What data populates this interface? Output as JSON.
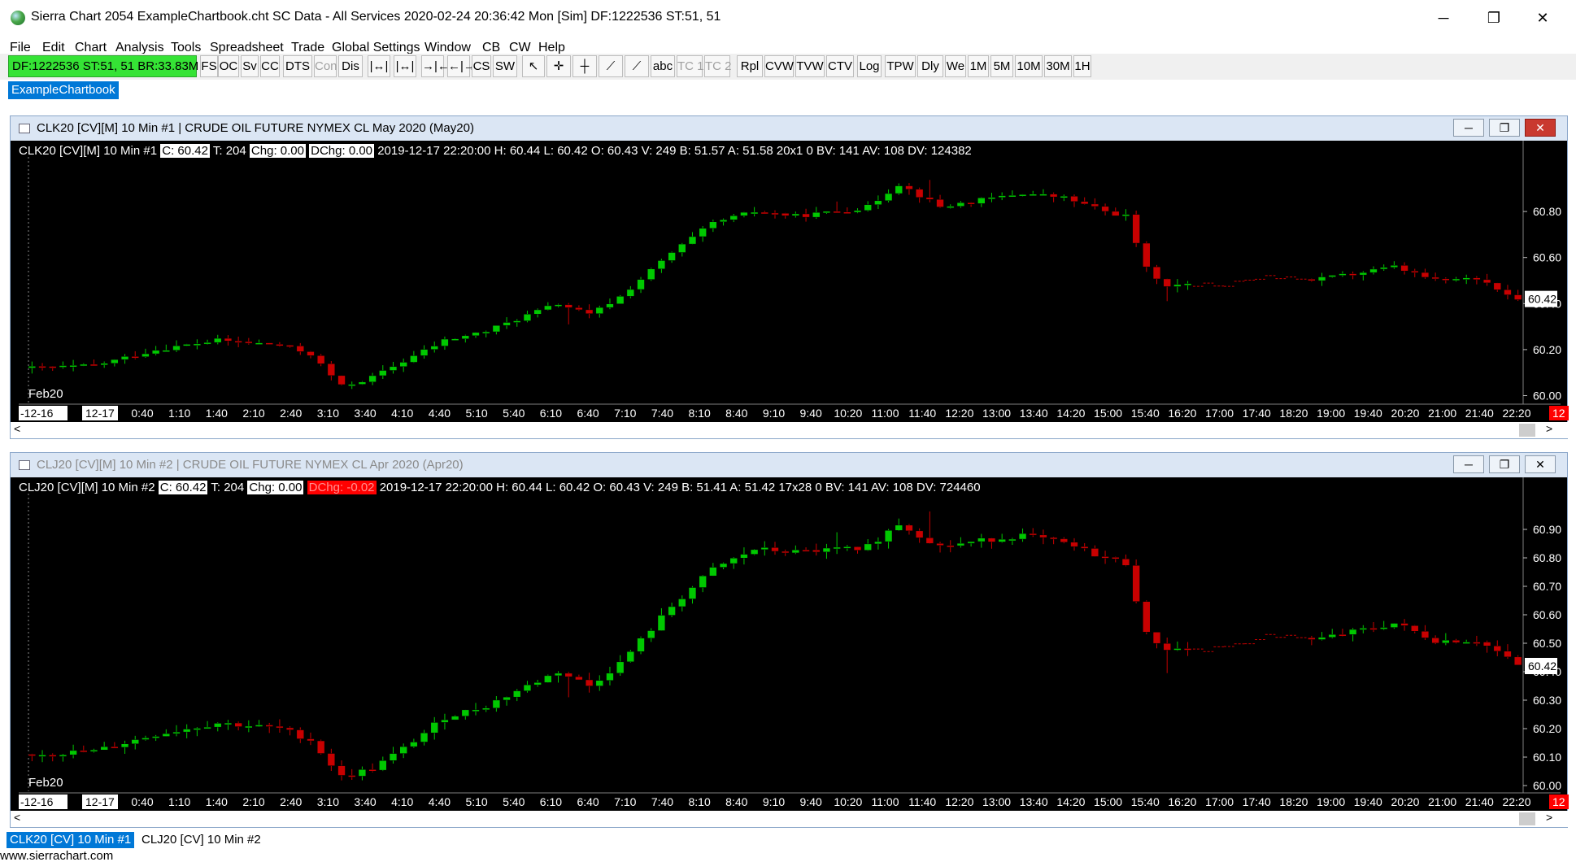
{
  "window": {
    "title": "Sierra Chart 2054 ExampleChartbook.cht  SC Data - All Services 2020-02-24  20:36:42 Mon [Sim]  DF:1222536  ST:51, 51",
    "minimize_glyph": "─",
    "maximize_glyph": "❐",
    "close_glyph": "✕"
  },
  "menu": [
    "File",
    "Edit",
    "Chart",
    "Analysis",
    "Tools",
    "Spreadsheet",
    "Trade",
    "Global Settings",
    "Window",
    "CB",
    "CW",
    "Help"
  ],
  "toolbar": {
    "status": "DF:1222536  ST:51, 51  BR:33.83M",
    "buttons": [
      {
        "label": "FS",
        "disabled": false
      },
      {
        "label": "OC",
        "disabled": false
      },
      {
        "label": "Sv",
        "disabled": false
      },
      {
        "label": "CC",
        "disabled": false
      },
      {
        "label": "DTS",
        "disabled": false
      },
      {
        "label": "Con",
        "disabled": true
      },
      {
        "label": "Dis",
        "disabled": false
      },
      {
        "label": "|↔|",
        "disabled": false
      },
      {
        "label": "|↔|",
        "disabled": false
      },
      {
        "label": "→|←",
        "disabled": false
      },
      {
        "label": "←|→",
        "disabled": false
      },
      {
        "label": "CS",
        "disabled": false
      },
      {
        "label": "SW",
        "disabled": false
      },
      {
        "label": "↖",
        "disabled": false
      },
      {
        "label": "✛",
        "disabled": false
      },
      {
        "label": "┼",
        "disabled": false
      },
      {
        "label": "⟋",
        "disabled": false
      },
      {
        "label": "⟋",
        "disabled": false
      },
      {
        "label": "abc",
        "disabled": false
      },
      {
        "label": "TC 1",
        "disabled": true
      },
      {
        "label": "TC 2",
        "disabled": true
      },
      {
        "label": "Rpl",
        "disabled": false
      },
      {
        "label": "CVW",
        "disabled": false
      },
      {
        "label": "TVW",
        "disabled": false
      },
      {
        "label": "CTV",
        "disabled": false
      },
      {
        "label": "Log",
        "disabled": false
      },
      {
        "label": "TPW",
        "disabled": false
      },
      {
        "label": "Dly",
        "disabled": false
      },
      {
        "label": "We",
        "disabled": false
      },
      {
        "label": "1M",
        "disabled": false
      },
      {
        "label": "5M",
        "disabled": false
      },
      {
        "label": "10M",
        "disabled": false
      },
      {
        "label": "30M",
        "disabled": false
      },
      {
        "label": "1H",
        "disabled": false
      }
    ]
  },
  "chartbook_tab": "ExampleChartbook",
  "time_labels": [
    "0:40",
    "1:10",
    "1:40",
    "2:10",
    "2:40",
    "3:10",
    "3:40",
    "4:10",
    "4:40",
    "5:10",
    "5:40",
    "6:10",
    "6:40",
    "7:10",
    "7:40",
    "8:10",
    "8:40",
    "9:10",
    "9:40",
    "10:20",
    "11:00",
    "11:40",
    "12:20",
    "13:00",
    "13:40",
    "14:20",
    "15:00",
    "15:40",
    "16:20",
    "17:00",
    "17:40",
    "18:20",
    "19:00",
    "19:40",
    "20:20",
    "21:00",
    "21:40",
    "22:20"
  ],
  "colors": {
    "up_candle": "#00c800",
    "down_candle": "#c80000",
    "background": "#000000",
    "axis_text": "#ffffff",
    "last_price_box": "#ffffff",
    "status_green": "#35e335"
  },
  "charts": [
    {
      "window_title": "CLK20 [CV][M]  10 Min   #1 | CRUDE OIL FUTURE NYMEX CL May 2020 (May20)",
      "title_dim": false,
      "info_prefix": "CLK20 [CV][M]  10 Min   #1",
      "info_close": "C: 60.42",
      "info_trades": "T: 204",
      "info_chg": "Chg: 0.00",
      "info_dchg": "DChg: 0.00",
      "info_dchg_negative": false,
      "info_rest": "2019-12-17 22:20:00 H: 60.44  L: 60.42  O: 60.43  V: 249  B: 51.57  A: 51.58  20x1  0  BV: 141  AV: 108  DV: 124382",
      "contract_label": "Feb20",
      "date_start": "-12-16",
      "date_current": "12-17",
      "end_marker": "12",
      "last_price": "60.42",
      "y_ticks": [
        "60.00",
        "60.20",
        "60.40",
        "60.60",
        "60.80"
      ],
      "ylim": [
        59.97,
        61.03
      ]
    },
    {
      "window_title": "CLJ20 [CV][M]  10 Min   #2 | CRUDE OIL FUTURE NYMEX CL Apr 2020 (Apr20)",
      "title_dim": true,
      "info_prefix": "CLJ20 [CV][M]  10 Min   #2",
      "info_close": "C: 60.42",
      "info_trades": "T: 204",
      "info_chg": "Chg: 0.00",
      "info_dchg": "DChg: -0.02",
      "info_dchg_negative": true,
      "info_rest": "2019-12-17 22:20:00 H: 60.44  L: 60.42  O: 60.43  V: 249  B: 51.41  A: 51.42  17x28  0  BV: 141  AV: 108  DV: 724460",
      "contract_label": "Feb20",
      "date_start": "-12-16",
      "date_current": "12-17",
      "end_marker": "12",
      "last_price": "60.42",
      "y_ticks": [
        "60.00",
        "60.10",
        "60.20",
        "60.30",
        "60.40",
        "60.50",
        "60.60",
        "60.70",
        "60.80",
        "60.90"
      ],
      "ylim": [
        59.98,
        61.02
      ]
    }
  ],
  "chart_data": [
    {
      "type": "candlestick",
      "symbol": "CLK20",
      "interval": "10 Min",
      "close_path": [
        [
          0,
          60.12
        ],
        [
          6,
          60.13
        ],
        [
          12,
          60.2
        ],
        [
          18,
          60.24
        ],
        [
          24,
          60.22
        ],
        [
          27,
          60.18
        ],
        [
          30,
          60.04
        ],
        [
          33,
          60.08
        ],
        [
          36,
          60.15
        ],
        [
          40,
          60.24
        ],
        [
          44,
          60.28
        ],
        [
          48,
          60.35
        ],
        [
          51,
          60.4
        ],
        [
          54,
          60.35
        ],
        [
          57,
          60.43
        ],
        [
          62,
          60.62
        ],
        [
          66,
          60.75
        ],
        [
          70,
          60.8
        ],
        [
          74,
          60.78
        ],
        [
          78,
          60.8
        ],
        [
          81,
          60.82
        ],
        [
          84,
          60.92
        ],
        [
          88,
          60.82
        ],
        [
          92,
          60.85
        ],
        [
          96,
          60.88
        ],
        [
          100,
          60.86
        ],
        [
          104,
          60.8
        ],
        [
          106,
          60.78
        ],
        [
          108,
          60.55
        ],
        [
          110,
          60.48
        ],
        [
          116,
          60.48
        ],
        [
          120,
          60.52
        ],
        [
          124,
          60.5
        ],
        [
          128,
          60.53
        ],
        [
          132,
          60.56
        ],
        [
          136,
          60.5
        ],
        [
          140,
          60.51
        ],
        [
          142,
          60.47
        ],
        [
          144,
          60.42
        ]
      ]
    },
    {
      "type": "candlestick",
      "symbol": "CLJ20",
      "interval": "10 Min",
      "close_path": [
        [
          0,
          60.11
        ],
        [
          6,
          60.12
        ],
        [
          12,
          60.18
        ],
        [
          18,
          60.22
        ],
        [
          24,
          60.2
        ],
        [
          27,
          60.16
        ],
        [
          30,
          60.03
        ],
        [
          33,
          60.06
        ],
        [
          36,
          60.13
        ],
        [
          40,
          60.24
        ],
        [
          44,
          60.28
        ],
        [
          48,
          60.35
        ],
        [
          51,
          60.4
        ],
        [
          54,
          60.35
        ],
        [
          57,
          60.43
        ],
        [
          62,
          60.63
        ],
        [
          66,
          60.76
        ],
        [
          70,
          60.83
        ],
        [
          74,
          60.82
        ],
        [
          78,
          60.83
        ],
        [
          81,
          60.84
        ],
        [
          84,
          60.92
        ],
        [
          88,
          60.84
        ],
        [
          92,
          60.86
        ],
        [
          96,
          60.88
        ],
        [
          100,
          60.85
        ],
        [
          104,
          60.8
        ],
        [
          106,
          60.78
        ],
        [
          108,
          60.53
        ],
        [
          110,
          60.48
        ],
        [
          116,
          60.48
        ],
        [
          120,
          60.53
        ],
        [
          124,
          60.51
        ],
        [
          128,
          60.54
        ],
        [
          132,
          60.57
        ],
        [
          136,
          60.51
        ],
        [
          140,
          60.51
        ],
        [
          142,
          60.47
        ],
        [
          144,
          60.42
        ]
      ]
    }
  ],
  "sheet_tabs": [
    {
      "label": "CLK20 [CV]  10 Min   #1",
      "active": true
    },
    {
      "label": "CLJ20 [CV]  10 Min   #2",
      "active": false
    }
  ],
  "footer_url": "www.sierrachart.com"
}
